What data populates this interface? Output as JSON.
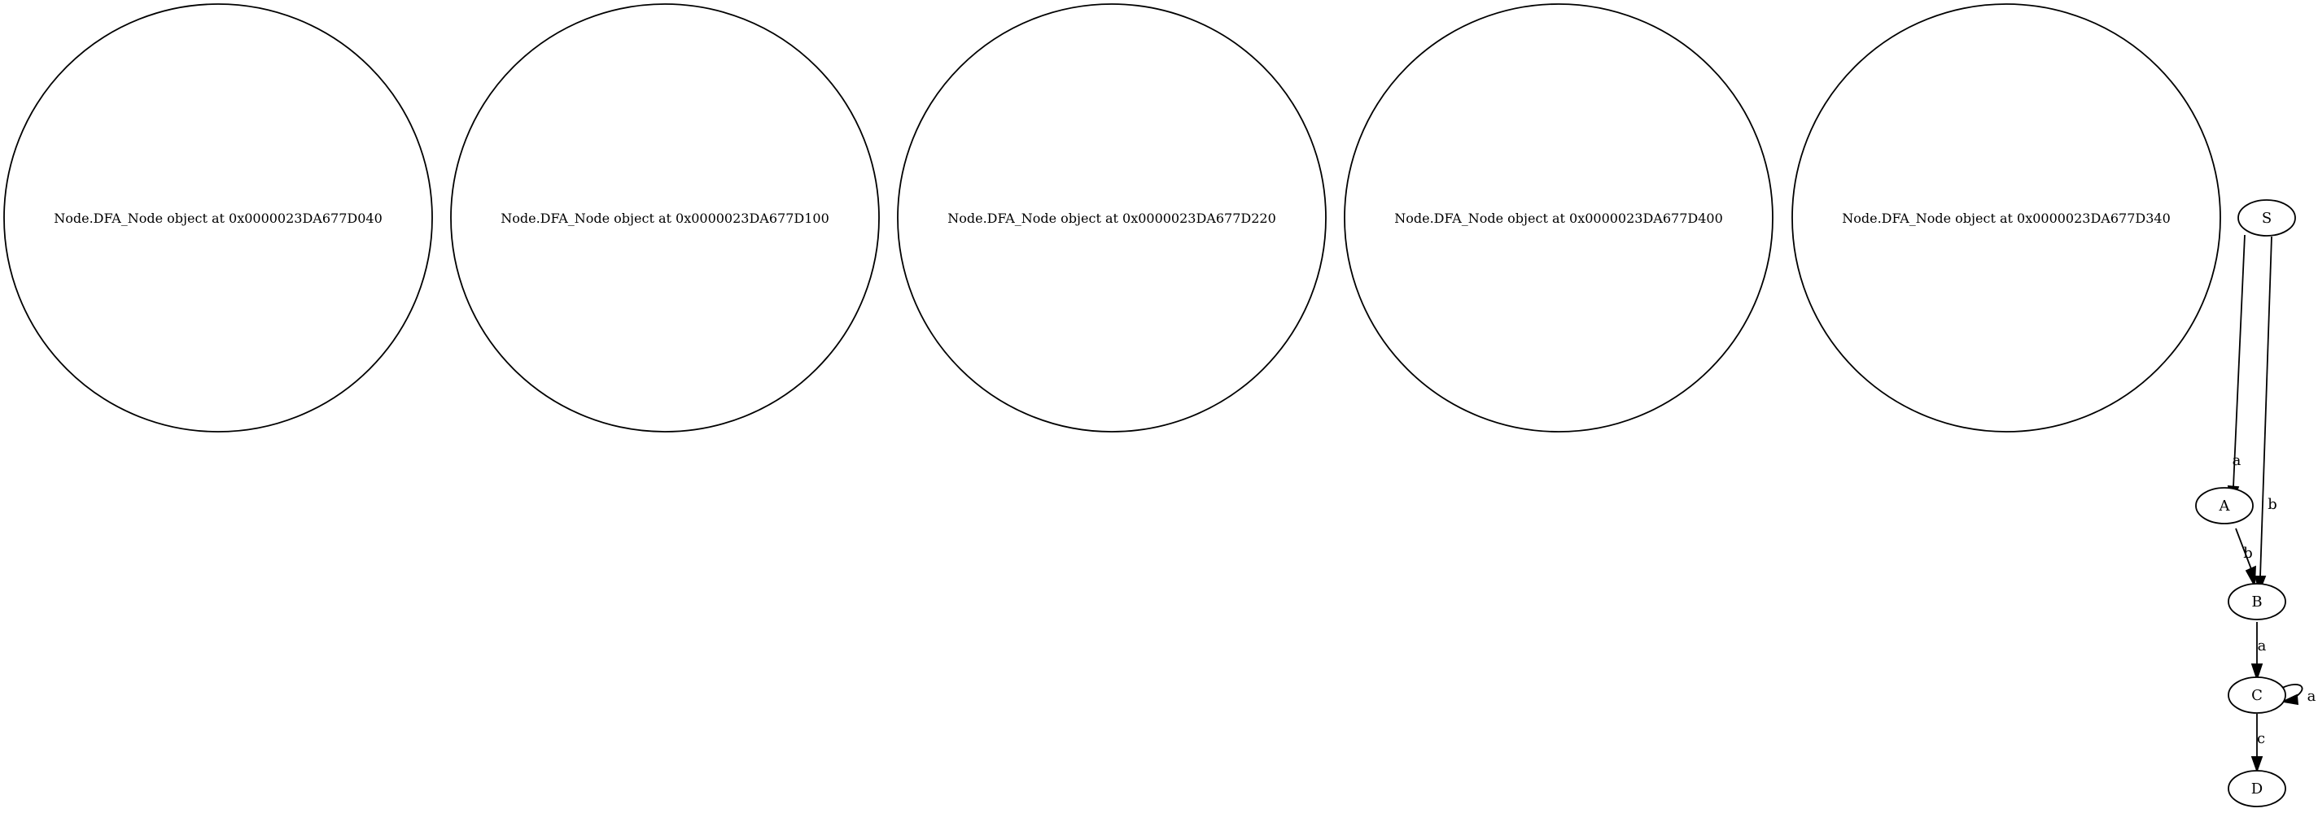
{
  "graph": {
    "object_nodes": [
      {
        "id": "n040",
        "label": "Node.DFA_Node object at 0x0000023DA677D040"
      },
      {
        "id": "n100",
        "label": "Node.DFA_Node object at 0x0000023DA677D100"
      },
      {
        "id": "n220",
        "label": "Node.DFA_Node object at 0x0000023DA677D220"
      },
      {
        "id": "n400",
        "label": "Node.DFA_Node object at 0x0000023DA677D400"
      },
      {
        "id": "n340",
        "label": "Node.DFA_Node object at 0x0000023DA677D340"
      }
    ],
    "states": [
      {
        "id": "S",
        "label": "S"
      },
      {
        "id": "A",
        "label": "A"
      },
      {
        "id": "B",
        "label": "B"
      },
      {
        "id": "C",
        "label": "C"
      },
      {
        "id": "D",
        "label": "D"
      }
    ],
    "transitions": [
      {
        "from": "S",
        "to": "A",
        "label": "a"
      },
      {
        "from": "S",
        "to": "B",
        "label": "b"
      },
      {
        "from": "A",
        "to": "B",
        "label": "b"
      },
      {
        "from": "B",
        "to": "C",
        "label": "a"
      },
      {
        "from": "C",
        "to": "C",
        "label": "a"
      },
      {
        "from": "C",
        "to": "D",
        "label": "c"
      }
    ]
  }
}
